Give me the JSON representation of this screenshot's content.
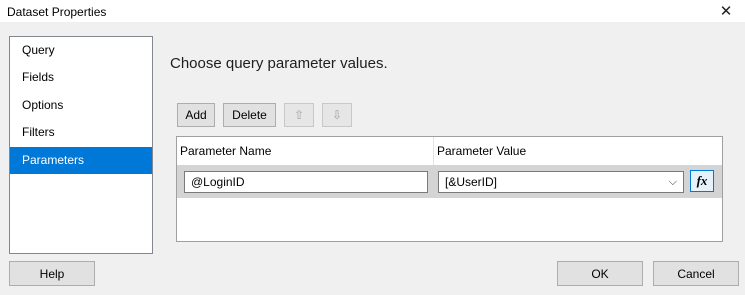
{
  "window": {
    "title": "Dataset Properties",
    "close_icon": "close-icon",
    "close_glyph": "✕"
  },
  "nav": {
    "items": [
      {
        "label": "Query"
      },
      {
        "label": "Fields"
      },
      {
        "label": "Options"
      },
      {
        "label": "Filters"
      },
      {
        "label": "Parameters",
        "selected": true
      }
    ]
  },
  "main": {
    "heading": "Choose query parameter values.",
    "toolbar": {
      "add_label": "Add",
      "delete_label": "Delete",
      "move_up_icon": "arrow-up-icon",
      "move_up_glyph": "⇧",
      "move_down_icon": "arrow-down-icon",
      "move_down_glyph": "⇩"
    },
    "grid": {
      "columns": [
        "Parameter Name",
        "Parameter Value"
      ],
      "rows": [
        {
          "name": "@LoginID",
          "value": "[&UserID]",
          "expression_icon": "fx-icon",
          "expression_glyph": "fx",
          "dropdown_glyph": "⌵"
        }
      ]
    }
  },
  "footer": {
    "help_label": "Help",
    "ok_label": "OK",
    "cancel_label": "Cancel"
  },
  "colors": {
    "selection": "#0078d7",
    "dialog_background": "#f0f0f0"
  }
}
